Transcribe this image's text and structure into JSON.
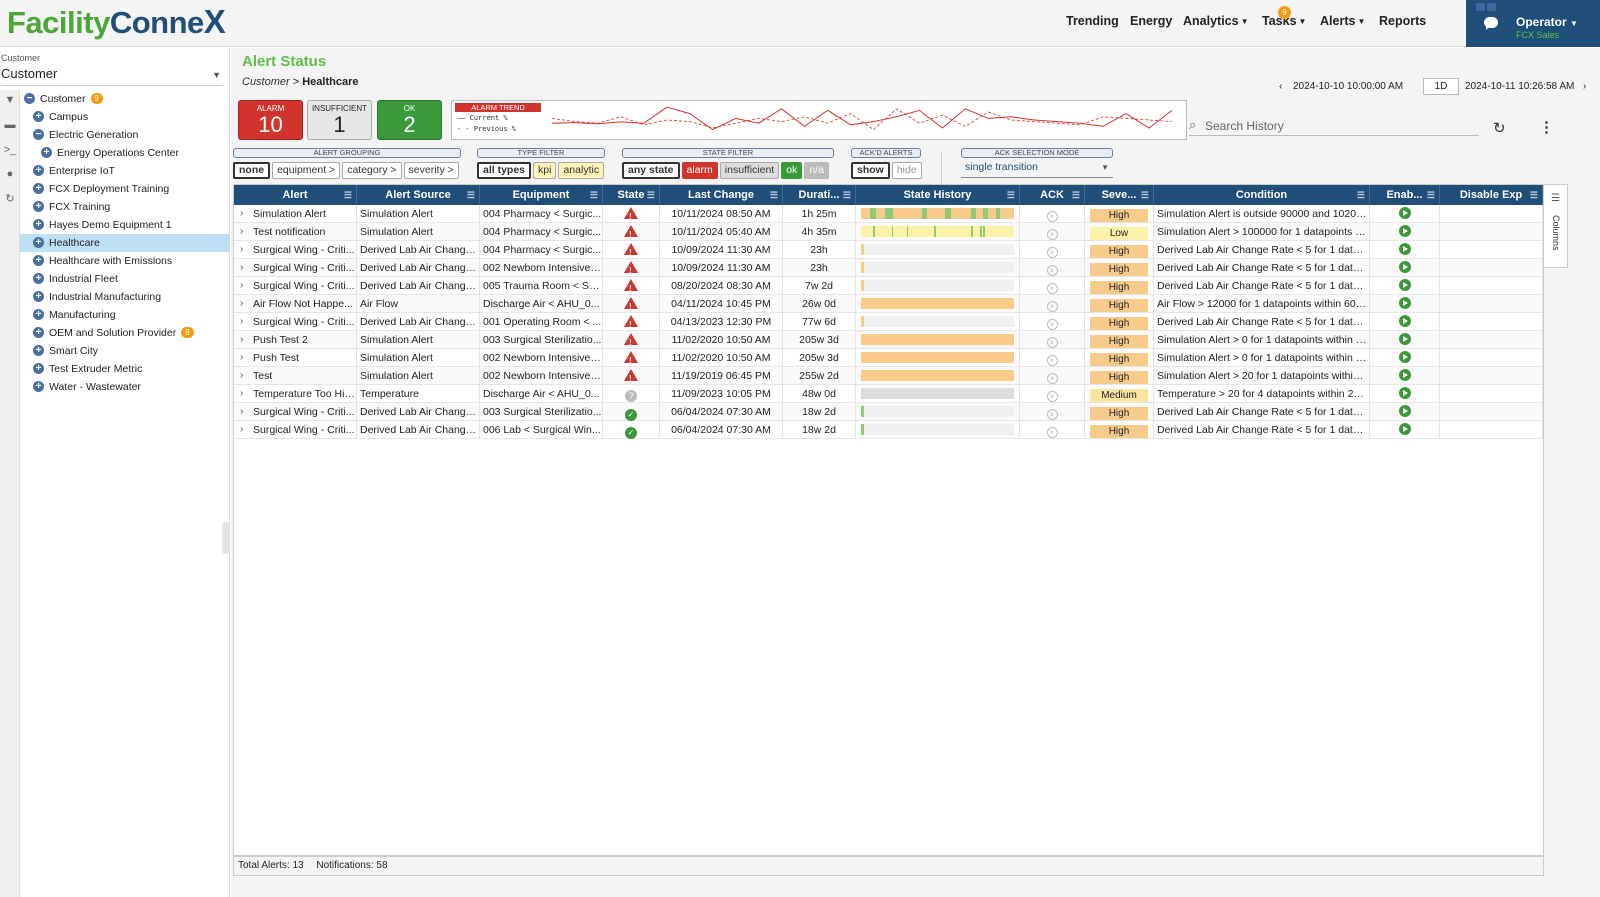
{
  "header": {
    "logo_part1": "Facility",
    "logo_part2": "Conne",
    "logo_x": "X",
    "nav": [
      "Trending",
      "Energy",
      "Analytics",
      "Tasks",
      "Alerts",
      "Reports"
    ],
    "tasks_badge": "9",
    "user_name": "Operator",
    "user_org": "FCX Sales"
  },
  "sidebar": {
    "label": "Customer",
    "select_value": "Customer",
    "tree": [
      {
        "label": "Customer",
        "level": 0,
        "expanded": true,
        "count": "9",
        "selected": false
      },
      {
        "label": "Campus",
        "level": 1,
        "expanded": false,
        "count": "",
        "selected": false
      },
      {
        "label": "Electric Generation",
        "level": 1,
        "expanded": true,
        "count": "",
        "selected": false
      },
      {
        "label": "Energy Operations Center",
        "level": 2,
        "expanded": false,
        "count": "",
        "selected": false
      },
      {
        "label": "Enterprise IoT",
        "level": 1,
        "expanded": false,
        "count": "",
        "selected": false
      },
      {
        "label": "FCX Deployment Training",
        "level": 1,
        "expanded": false,
        "count": "",
        "selected": false
      },
      {
        "label": "FCX Training",
        "level": 1,
        "expanded": false,
        "count": "",
        "selected": false
      },
      {
        "label": "Hayes Demo Equipment 1",
        "level": 1,
        "expanded": false,
        "count": "",
        "selected": false
      },
      {
        "label": "Healthcare",
        "level": 1,
        "expanded": false,
        "count": "",
        "selected": true
      },
      {
        "label": "Healthcare with Emissions",
        "level": 1,
        "expanded": false,
        "count": "",
        "selected": false
      },
      {
        "label": "Industrial Fleet",
        "level": 1,
        "expanded": false,
        "count": "",
        "selected": false
      },
      {
        "label": "Industrial Manufacturing",
        "level": 1,
        "expanded": false,
        "count": "",
        "selected": false
      },
      {
        "label": "Manufacturing",
        "level": 1,
        "expanded": false,
        "count": "",
        "selected": false
      },
      {
        "label": "OEM and Solution Provider",
        "level": 1,
        "expanded": false,
        "count": "9",
        "selected": false
      },
      {
        "label": "Smart City",
        "level": 1,
        "expanded": false,
        "count": "",
        "selected": false
      },
      {
        "label": "Test Extruder Metric",
        "level": 1,
        "expanded": false,
        "count": "",
        "selected": false
      },
      {
        "label": "Water - Wastewater",
        "level": 1,
        "expanded": false,
        "count": "",
        "selected": false
      }
    ]
  },
  "page": {
    "title": "Alert Status",
    "breadcrumb_parent": "Customer",
    "breadcrumb_sep": " > ",
    "breadcrumb_current": "Healthcare",
    "date_start": "2024-10-10 10:00:00 AM",
    "range": "1D",
    "date_end": "2024-10-11 10:26:58 AM"
  },
  "summary": {
    "alarm_label": "ALARM",
    "alarm_count": "10",
    "insufficient_label": "INSUFFICIENT",
    "insufficient_count": "1",
    "ok_label": "OK",
    "ok_count": "2"
  },
  "trend": {
    "tag": "ALARM TREND",
    "current_label": "Current %",
    "previous_label": "Previous %",
    "current": [
      40,
      42,
      38,
      44,
      40,
      90,
      70,
      20,
      55,
      40,
      85,
      30,
      80,
      35,
      45,
      60,
      80,
      25,
      85,
      55,
      60,
      50,
      45,
      40,
      30,
      70,
      25,
      80
    ],
    "previous": [
      55,
      45,
      40,
      60,
      35,
      50,
      45,
      25,
      40,
      55,
      45,
      60,
      40,
      70,
      20,
      85,
      40,
      65,
      30,
      75,
      50,
      45,
      40,
      35,
      60,
      55,
      50,
      45
    ],
    "colors": {
      "current": "#d0342c",
      "previous": "#d0342c"
    }
  },
  "search": {
    "placeholder": "Search History"
  },
  "filters": {
    "grouping": {
      "title": "ALERT GROUPING",
      "options": [
        "none",
        "equipment >",
        "category >",
        "severity >"
      ],
      "active": "none"
    },
    "type": {
      "title": "TYPE FILTER",
      "options": [
        "all types",
        "kpi",
        "analytic"
      ],
      "active": "all types"
    },
    "state": {
      "title": "STATE FILTER",
      "options": [
        "any state",
        "alarm",
        "insufficient",
        "ok",
        "n/a"
      ],
      "active": "any state"
    },
    "ackd": {
      "title": "ACK'D ALERTS",
      "options": [
        "show",
        "hide"
      ],
      "active": "show"
    },
    "ack_mode": {
      "title": "ACK SELECTION MODE",
      "value": "single transition"
    }
  },
  "grid": {
    "columns": [
      "Alert",
      "Alert Source",
      "Equipment",
      "State",
      "Last Change",
      "Durati...",
      "State History",
      "ACK",
      "Seve...",
      "Condition",
      "Enab...",
      "Disable Exp"
    ],
    "rows": [
      {
        "alert": "Simulation Alert",
        "source": "Simulation Alert",
        "equipment": "004 Pharmacy < Surgic...",
        "state": "alarm",
        "last_change": "10/11/2024 08:50 AM",
        "duration": "1h 25m",
        "history": "mixed",
        "severity": "High",
        "condition": "Simulation Alert is outside 90000 and 102000..."
      },
      {
        "alert": "Test notification",
        "source": "Simulation Alert",
        "equipment": "004 Pharmacy < Surgic...",
        "state": "alarm",
        "last_change": "10/11/2024 05:40 AM",
        "duration": "4h 35m",
        "history": "sparse",
        "severity": "Low",
        "condition": "Simulation Alert > 100000 for 1 datapoints wi..."
      },
      {
        "alert": "Surgical Wing - Criti...",
        "source": "Derived Lab Air Change...",
        "equipment": "004 Pharmacy < Surgic...",
        "state": "alarm",
        "last_change": "10/09/2024 11:30 AM",
        "duration": "23h",
        "history": "tiny",
        "severity": "High",
        "condition": "Derived Lab Air Change Rate < 5 for 1 datap..."
      },
      {
        "alert": "Surgical Wing - Criti...",
        "source": "Derived Lab Air Change...",
        "equipment": "002 Newborn Intensive ...",
        "state": "alarm",
        "last_change": "10/09/2024 11:30 AM",
        "duration": "23h",
        "history": "tiny",
        "severity": "High",
        "condition": "Derived Lab Air Change Rate < 5 for 1 datap..."
      },
      {
        "alert": "Surgical Wing - Criti...",
        "source": "Derived Lab Air Change...",
        "equipment": "005 Trauma Room < Su...",
        "state": "alarm",
        "last_change": "08/20/2024 08:30 AM",
        "duration": "7w 2d",
        "history": "tiny",
        "severity": "High",
        "condition": "Derived Lab Air Change Rate < 5 for 1 datap..."
      },
      {
        "alert": "Air Flow Not Happe...",
        "source": "Air Flow",
        "equipment": "Discharge Air < AHU_0...",
        "state": "alarm",
        "last_change": "04/11/2024 10:45 PM",
        "duration": "26w 0d",
        "history": "full",
        "severity": "High",
        "condition": "Air Flow > 12000 for 1 datapoints within 60 m..."
      },
      {
        "alert": "Surgical Wing - Criti...",
        "source": "Derived Lab Air Change...",
        "equipment": "001 Operating Room < ...",
        "state": "alarm",
        "last_change": "04/13/2023 12:30 PM",
        "duration": "77w 6d",
        "history": "tiny",
        "severity": "High",
        "condition": "Derived Lab Air Change Rate < 5 for 1 datap..."
      },
      {
        "alert": "Push Test 2",
        "source": "Simulation Alert",
        "equipment": "003 Surgical Sterilizatio...",
        "state": "alarm",
        "last_change": "11/02/2020 10:50 AM",
        "duration": "205w 3d",
        "history": "full",
        "severity": "High",
        "condition": "Simulation Alert > 0 for 1 datapoints within 25..."
      },
      {
        "alert": "Push Test",
        "source": "Simulation Alert",
        "equipment": "002 Newborn Intensive ...",
        "state": "alarm",
        "last_change": "11/02/2020 10:50 AM",
        "duration": "205w 3d",
        "history": "full",
        "severity": "High",
        "condition": "Simulation Alert > 0 for 1 datapoints within 25..."
      },
      {
        "alert": "Test",
        "source": "Simulation Alert",
        "equipment": "002 Newborn Intensive ...",
        "state": "alarm",
        "last_change": "11/19/2019 06:45 PM",
        "duration": "255w 2d",
        "history": "full",
        "severity": "High",
        "condition": "Simulation Alert > 20 for 1 datapoints within 2..."
      },
      {
        "alert": "Temperature Too High",
        "source": "Temperature",
        "equipment": "Discharge Air < AHU_0...",
        "state": "insufficient",
        "last_change": "11/09/2023 10:05 PM",
        "duration": "48w 0d",
        "history": "grey",
        "severity": "Medium",
        "condition": "Temperature > 20 for 4 datapoints within 20 ..."
      },
      {
        "alert": "Surgical Wing - Criti...",
        "source": "Derived Lab Air Change...",
        "equipment": "003 Surgical Sterilizatio...",
        "state": "ok",
        "last_change": "06/04/2024 07:30 AM",
        "duration": "18w 2d",
        "history": "tinygreen",
        "severity": "High",
        "condition": "Derived Lab Air Change Rate < 5 for 1 datap..."
      },
      {
        "alert": "Surgical Wing - Criti...",
        "source": "Derived Lab Air Change...",
        "equipment": "006 Lab < Surgical Win...",
        "state": "ok",
        "last_change": "06/04/2024 07:30 AM",
        "duration": "18w 2d",
        "history": "tinygreen",
        "severity": "High",
        "condition": "Derived Lab Air Change Rate < 5 for 1 datap..."
      }
    ]
  },
  "footer": {
    "total": "Total Alerts: 13",
    "notifications": "Notifications: 58"
  },
  "columns_panel": {
    "label": "Columns"
  },
  "colors": {
    "brand_green": "#4ca63a",
    "brand_blue": "#1f4e79",
    "alarm": "#d0342c",
    "ok": "#3a9a3a",
    "severity_high": "#f8cb8a",
    "severity_low": "#fbf2a8"
  }
}
